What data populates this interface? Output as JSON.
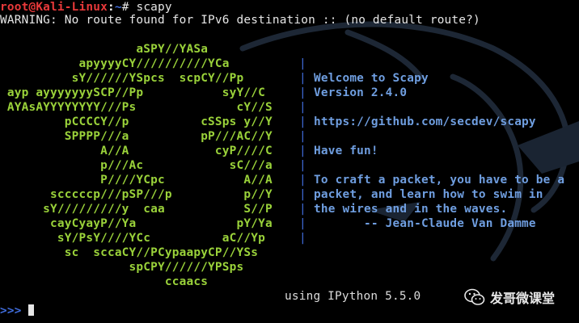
{
  "terminal": {
    "prompt": {
      "user_host": "root@Kali-Linux",
      "separator": ":",
      "path": "~",
      "symbol": "# ",
      "command": "scapy"
    },
    "warning": "WARNING: No route found for IPv6 destination :: (no default route?)",
    "banner_art": [
      "                   aSPY//YASa",
      "           apyyyyCY//////////YCa",
      "          sY//////YSpcs  scpCY//Pp",
      " ayp ayyyyyyySCP//Pp           syY//C",
      " AYAsAYYYYYYYY///Ps              cY//S",
      "         pCCCCY//p          cSSps y//Y",
      "         SPPPP///a          pP///AC//Y",
      "              A//A            cyP////C",
      "              p///Ac            sC///a",
      "              P////YCpc           A//A",
      "       scccccp///pSP///p          p//Y",
      "      sY/////////y  caa           S//P",
      "       cayCyayP//Ya              pY/Ya",
      "        sY/PsY////YCc          aC//Yp",
      "         sc  sccaCY//PCypaapyCP//YSs",
      "                  spCPY//////YPSps",
      "                       ccaacs"
    ],
    "banner_bar": "|",
    "banner_info": [
      "",
      "",
      "Welcome to Scapy",
      "Version 2.4.0",
      "",
      "https://github.com/secdev/scapy",
      "",
      "Have fun!",
      "",
      "To craft a packet, you have to be a",
      "packet, and learn how to swim in",
      "the wires and in the waves.",
      "       -- Jean-Claude Van Damme",
      ""
    ],
    "ipython_line": "using IPython 5.5.0",
    "ipython_prompt": ">>>"
  },
  "watermark": {
    "text": "发哥微课堂",
    "icon": "wechat-icon"
  },
  "colors": {
    "background": "#000000",
    "user_host": "#e8393a",
    "path": "#3f6bd9",
    "banner_art": "#9ad23a",
    "banner_text": "#6f9ee0",
    "dragon": "#1c2634"
  }
}
